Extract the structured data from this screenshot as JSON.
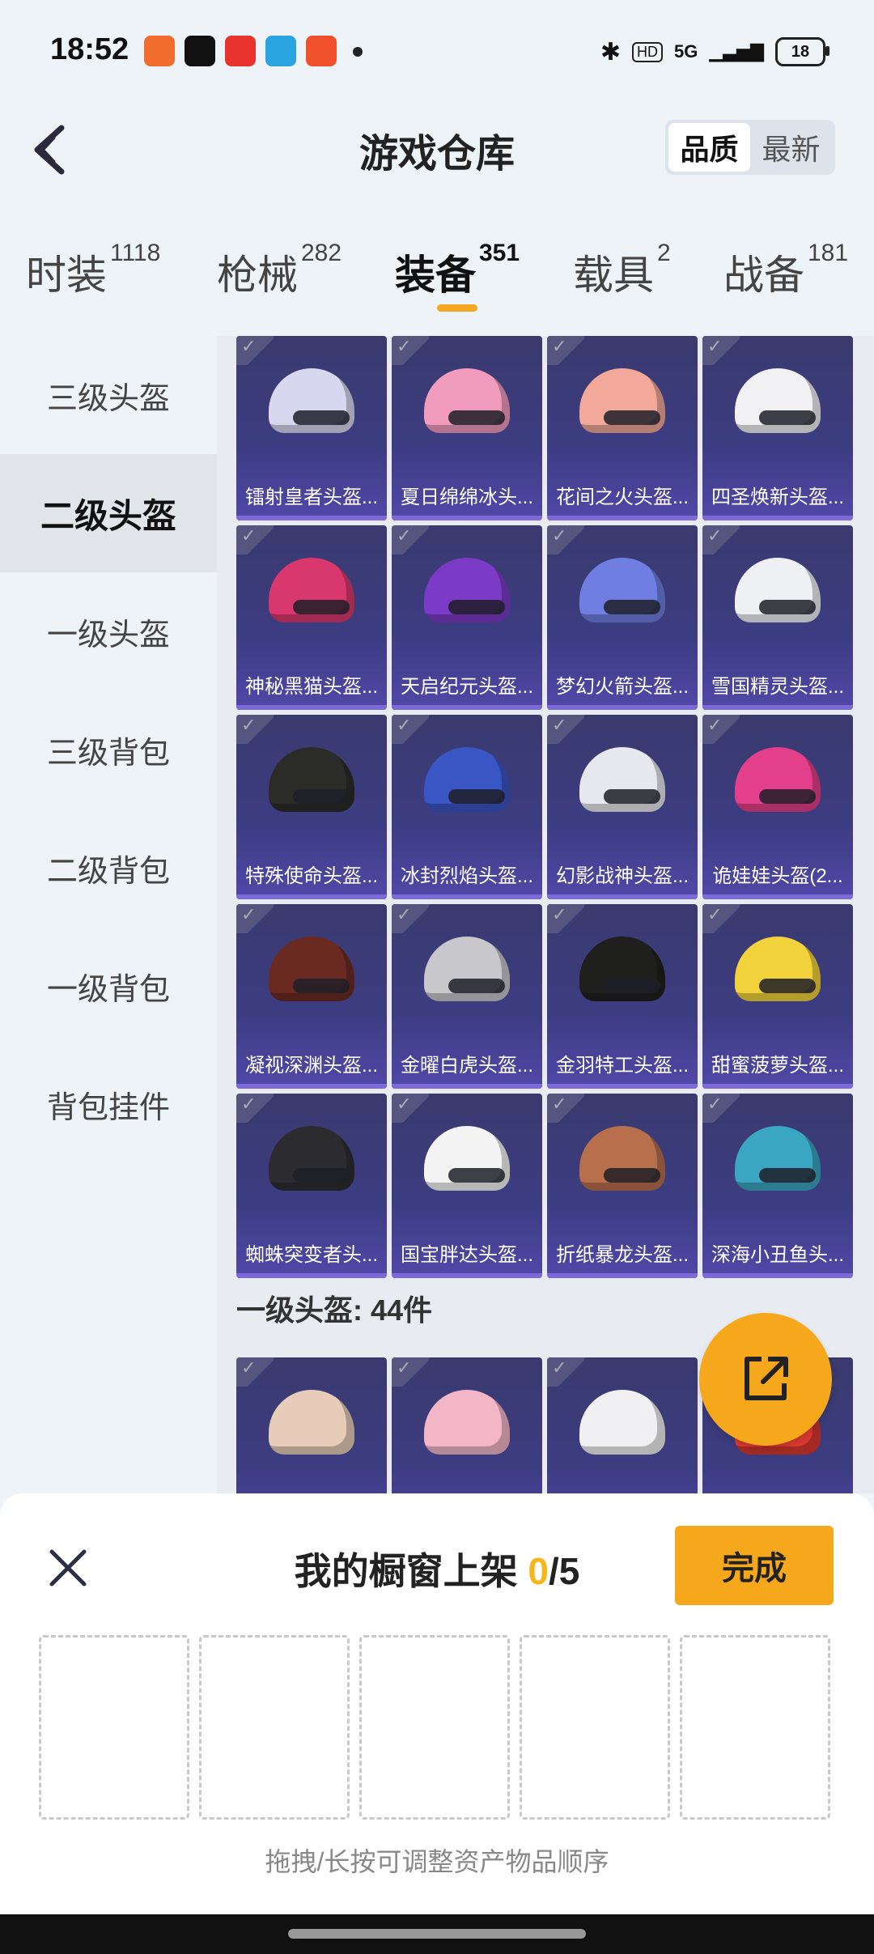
{
  "status": {
    "time": "18:52",
    "battery": "18",
    "network": "5G"
  },
  "header": {
    "title": "游戏仓库",
    "sort_quality": "品质",
    "sort_latest": "最新"
  },
  "tabs": [
    {
      "label": "时装",
      "count": "1118"
    },
    {
      "label": "枪械",
      "count": "282"
    },
    {
      "label": "装备",
      "count": "351"
    },
    {
      "label": "载具",
      "count": "2"
    },
    {
      "label": "战备",
      "count": "181"
    }
  ],
  "side": [
    "三级头盔",
    "二级头盔",
    "一级头盔",
    "三级背包",
    "二级背包",
    "一级背包",
    "背包挂件"
  ],
  "items": [
    {
      "name": "镭射皇者头盔...",
      "color": "#d7d7f0"
    },
    {
      "name": "夏日绵绵冰头...",
      "color": "#f19bbd"
    },
    {
      "name": "花间之火头盔...",
      "color": "#f2a99a"
    },
    {
      "name": "四圣焕新头盔...",
      "color": "#f1f1f4"
    },
    {
      "name": "神秘黑猫头盔...",
      "color": "#d8386e"
    },
    {
      "name": "天启纪元头盔...",
      "color": "#7b3bc6"
    },
    {
      "name": "梦幻火箭头盔...",
      "color": "#6f7ee0"
    },
    {
      "name": "雪国精灵头盔...",
      "color": "#eef0f4"
    },
    {
      "name": "特殊使命头盔...",
      "color": "#2b2b28"
    },
    {
      "name": "冰封烈焰头盔...",
      "color": "#3a56c4"
    },
    {
      "name": "幻影战神头盔...",
      "color": "#e7e7ee"
    },
    {
      "name": "诡娃娃头盔(2...",
      "color": "#e33f8a"
    },
    {
      "name": "凝视深渊头盔...",
      "color": "#6a2a22"
    },
    {
      "name": "金曜白虎头盔...",
      "color": "#c7c7cc"
    },
    {
      "name": "金羽特工头盔...",
      "color": "#1f1f1d"
    },
    {
      "name": "甜蜜菠萝头盔...",
      "color": "#f2d23b"
    },
    {
      "name": "蜘蛛突变者头...",
      "color": "#2c2c30"
    },
    {
      "name": "国宝胖达头盔...",
      "color": "#f4f4f4"
    },
    {
      "name": "折纸暴龙头盔...",
      "color": "#b86f4c"
    },
    {
      "name": "深海小丑鱼头...",
      "color": "#3aa6c2"
    }
  ],
  "section_title": "一级头盔: 44件",
  "items2": [
    {
      "color": "#e7cdb9"
    },
    {
      "color": "#f2b6c7"
    },
    {
      "color": "#f0f0f2"
    },
    {
      "color": "#d8392f"
    }
  ],
  "sheet": {
    "title_prefix": "我的橱窗上架 ",
    "count": "0",
    "total": "/5",
    "done": "完成",
    "hint": "拖拽/长按可调整资产物品顺序"
  }
}
